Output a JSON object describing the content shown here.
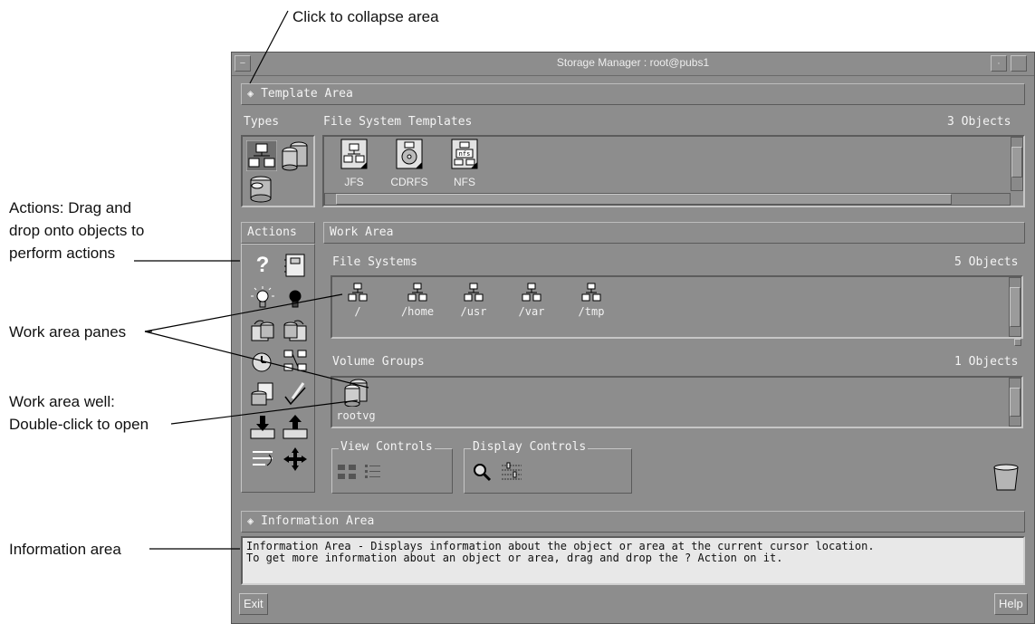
{
  "callouts": {
    "collapse": "Click to collapse area",
    "actions_line1": "Actions: Drag and",
    "actions_line2": "drop onto objects to",
    "actions_line3": "perform actions",
    "panes": "Work area panes",
    "well_line1": "Work area well:",
    "well_line2": "Double-click to open",
    "info": "Information area"
  },
  "window": {
    "title": "Storage Manager : root@pubs1",
    "menu_icon": "window-menu-icon",
    "minimize_icon": "minimize-icon"
  },
  "template_area": {
    "label": "Template Area",
    "types_label": "Types",
    "fs_templates_label": "File System Templates",
    "count": "3 Objects",
    "templates": [
      {
        "label": "JFS",
        "icon": "jfs-template-icon"
      },
      {
        "label": "CDRFS",
        "icon": "cdrfs-template-icon"
      },
      {
        "label": "NFS",
        "icon": "nfs-template-icon",
        "badge": "nfs"
      }
    ]
  },
  "actions": {
    "label": "Actions",
    "icons": [
      "help-icon",
      "notebook-icon",
      "lightbulb-on-icon",
      "lightbulb-off-icon",
      "backup-icon",
      "restore-icon",
      "schedule-icon",
      "network-icon",
      "report-icon",
      "checkmark-icon",
      "import-icon",
      "export-icon",
      "reorder-icon",
      "move-icon"
    ],
    "help_glyph": "?"
  },
  "work_area": {
    "label": "Work Area",
    "file_systems": {
      "label": "File Systems",
      "count": "5 Objects",
      "items": [
        "/",
        "/home",
        "/usr",
        "/var",
        "/tmp"
      ]
    },
    "volume_groups": {
      "label": "Volume Groups",
      "count": "1 Objects",
      "items": [
        "rootvg"
      ]
    },
    "view_controls_label": "View Controls",
    "display_controls_label": "Display Controls"
  },
  "info_area": {
    "label": "Information Area",
    "line1": "Information Area - Displays information about the object or area at the current cursor location.",
    "line2": "To get more information about an object or area, drag and drop the ? Action on it."
  },
  "buttons": {
    "exit": "Exit",
    "help": "Help"
  },
  "colors": {
    "window_bg": "#8d8d8d",
    "info_bg": "#e8e8e8",
    "text_light": "#f4f4f4"
  }
}
